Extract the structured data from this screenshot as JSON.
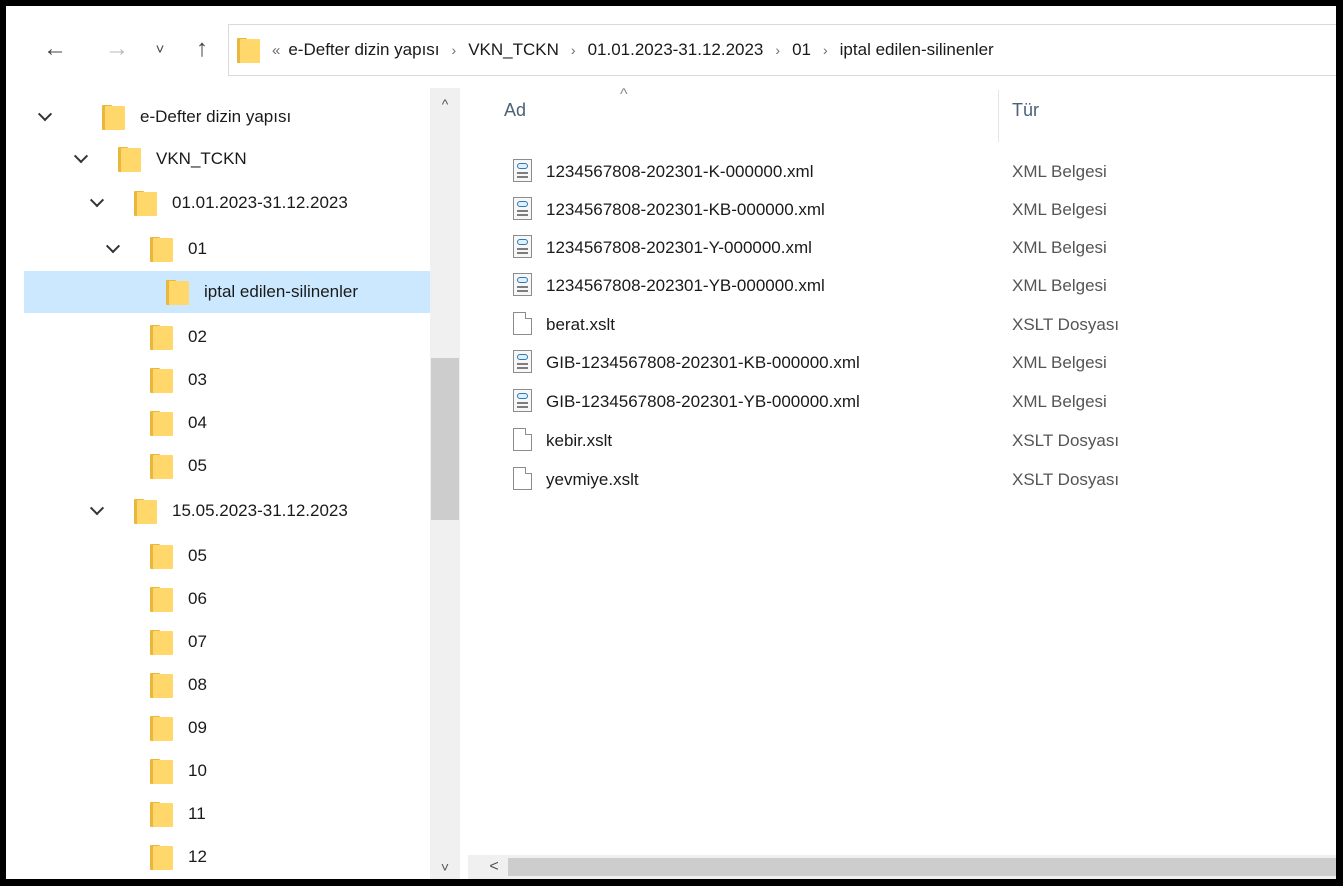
{
  "nav": {
    "back": "←",
    "forward": "→",
    "recent": "˅",
    "up": "↑"
  },
  "address": {
    "overflow": "«",
    "separator": "›",
    "crumbs": [
      "e-Defter dizin yapısı",
      "VKN_TCKN",
      "01.01.2023-31.12.2023",
      "01",
      "iptal edilen-silinenler"
    ]
  },
  "tree": [
    {
      "label": "e-Defter dizin yapısı",
      "expanded": true,
      "selected": false
    },
    {
      "label": "VKN_TCKN",
      "expanded": true,
      "selected": false
    },
    {
      "label": "01.01.2023-31.12.2023",
      "expanded": true,
      "selected": false
    },
    {
      "label": "01",
      "expanded": true,
      "selected": false
    },
    {
      "label": "iptal edilen-silinenler",
      "expanded": false,
      "selected": true
    },
    {
      "label": "02",
      "expanded": false,
      "selected": false
    },
    {
      "label": "03",
      "expanded": false,
      "selected": false
    },
    {
      "label": "04",
      "expanded": false,
      "selected": false
    },
    {
      "label": "05",
      "expanded": false,
      "selected": false
    },
    {
      "label": "15.05.2023-31.12.2023",
      "expanded": true,
      "selected": false
    },
    {
      "label": "05",
      "expanded": false,
      "selected": false
    },
    {
      "label": "06",
      "expanded": false,
      "selected": false
    },
    {
      "label": "07",
      "expanded": false,
      "selected": false
    },
    {
      "label": "08",
      "expanded": false,
      "selected": false
    },
    {
      "label": "09",
      "expanded": false,
      "selected": false
    },
    {
      "label": "10",
      "expanded": false,
      "selected": false
    },
    {
      "label": "11",
      "expanded": false,
      "selected": false
    },
    {
      "label": "12",
      "expanded": false,
      "selected": false
    }
  ],
  "columns": {
    "name": "Ad",
    "type": "Tür",
    "sort_indicator": "^"
  },
  "files": [
    {
      "name": "1234567808-202301-K-000000.xml",
      "type": "XML Belgesi",
      "icon": "xml-file-icon"
    },
    {
      "name": "1234567808-202301-KB-000000.xml",
      "type": "XML Belgesi",
      "icon": "xml-file-icon"
    },
    {
      "name": "1234567808-202301-Y-000000.xml",
      "type": "XML Belgesi",
      "icon": "xml-file-icon"
    },
    {
      "name": "1234567808-202301-YB-000000.xml",
      "type": "XML Belgesi",
      "icon": "xml-file-icon"
    },
    {
      "name": "berat.xslt",
      "type": "XSLT Dosyası",
      "icon": "blank-file-icon"
    },
    {
      "name": "GIB-1234567808-202301-KB-000000.xml",
      "type": "XML Belgesi",
      "icon": "xml-file-icon"
    },
    {
      "name": "GIB-1234567808-202301-YB-000000.xml",
      "type": "XML Belgesi",
      "icon": "xml-file-icon"
    },
    {
      "name": "kebir.xslt",
      "type": "XSLT Dosyası",
      "icon": "blank-file-icon"
    },
    {
      "name": "yevmiye.xslt",
      "type": "XSLT Dosyası",
      "icon": "blank-file-icon"
    }
  ],
  "scrollbars": {
    "up": "^",
    "down": "˅",
    "left": "<"
  },
  "colors": {
    "selection": "#cce8ff",
    "folder_front": "#ffd76a",
    "folder_back": "#e9b73b",
    "header_text": "#4c607a"
  }
}
